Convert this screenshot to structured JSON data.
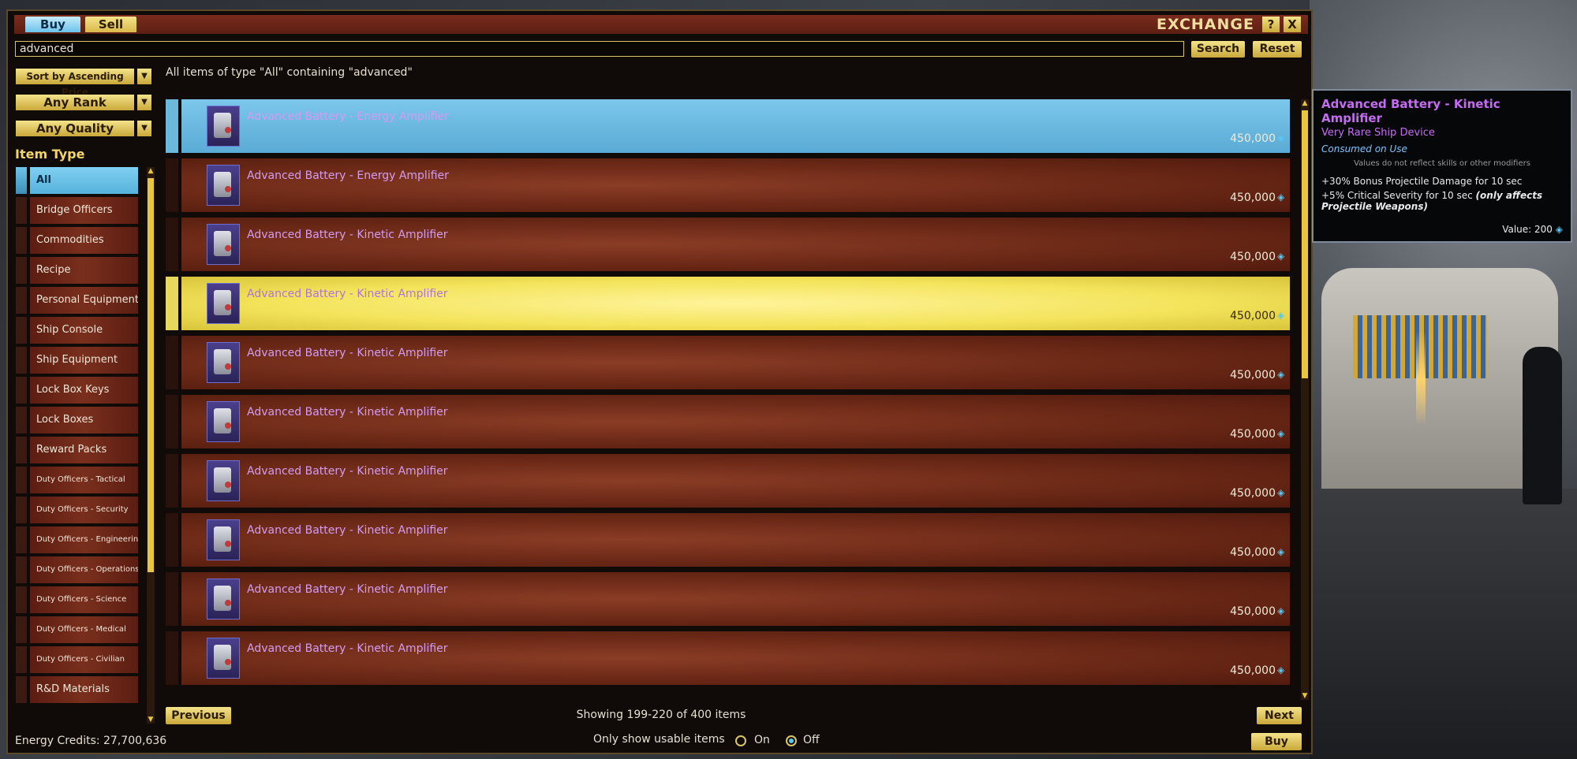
{
  "window": {
    "tabs": {
      "buy": "Buy",
      "sell": "Sell"
    },
    "title": "EXCHANGE",
    "help": "?",
    "close": "X"
  },
  "search": {
    "value": "advanced",
    "search_label": "Search",
    "reset_label": "Reset"
  },
  "filters": {
    "sort": "Sort by Ascending Price",
    "rank": "Any Rank",
    "quality": "Any Quality",
    "arrow": "▼"
  },
  "summary": "All items of type \"All\" containing \"advanced\"",
  "item_type": {
    "label": "Item Type",
    "items": [
      "All",
      "Bridge Officers",
      "Commodities",
      "Recipe",
      "Personal Equipment",
      "Ship Console",
      "Ship Equipment",
      "Lock Box Keys",
      "Lock Boxes",
      "Reward Packs",
      "Duty Officers - Tactical",
      "Duty Officers - Security",
      "Duty Officers - Engineering",
      "Duty Officers - Operations",
      "Duty Officers - Science",
      "Duty Officers - Medical",
      "Duty Officers - Civilian",
      "R&D Materials"
    ]
  },
  "results": {
    "rows": [
      {
        "name": "Advanced Battery - Energy Amplifier",
        "price": "450,000",
        "state": "selected"
      },
      {
        "name": "Advanced Battery - Energy Amplifier",
        "price": "450,000",
        "state": "normal"
      },
      {
        "name": "Advanced Battery - Kinetic Amplifier",
        "price": "450,000",
        "state": "normal"
      },
      {
        "name": "Advanced Battery - Kinetic Amplifier",
        "price": "450,000",
        "state": "hover"
      },
      {
        "name": "Advanced Battery - Kinetic Amplifier",
        "price": "450,000",
        "state": "normal"
      },
      {
        "name": "Advanced Battery - Kinetic Amplifier",
        "price": "450,000",
        "state": "normal"
      },
      {
        "name": "Advanced Battery - Kinetic Amplifier",
        "price": "450,000",
        "state": "normal"
      },
      {
        "name": "Advanced Battery - Kinetic Amplifier",
        "price": "450,000",
        "state": "normal"
      },
      {
        "name": "Advanced Battery - Kinetic Amplifier",
        "price": "450,000",
        "state": "normal"
      },
      {
        "name": "Advanced Battery - Kinetic Amplifier",
        "price": "450,000",
        "state": "normal"
      }
    ]
  },
  "pagination": {
    "previous": "Previous",
    "next": "Next",
    "showing": "Showing 199-220 of 400 items"
  },
  "usable": {
    "label": "Only show usable items",
    "on": "On",
    "off": "Off",
    "selected": "Off"
  },
  "footer": {
    "credits": "Energy Credits: 27,700,636",
    "buy": "Buy"
  },
  "tooltip": {
    "title": "Advanced Battery - Kinetic Amplifier",
    "subtitle": "Very Rare Ship Device",
    "consumed": "Consumed on Use",
    "note": "Values do not reflect skills or other modifiers",
    "line1": "+30% Bonus Projectile Damage for 10 sec",
    "line2": "+5% Critical Severity for 10 sec",
    "line2_em": "(only affects Projectile Weapons)",
    "value": "Value: 200"
  },
  "colors": {
    "accent_gold": "#e8c640",
    "selected_blue": "#6cc3ea",
    "item_name_purple": "#d39cf0"
  }
}
